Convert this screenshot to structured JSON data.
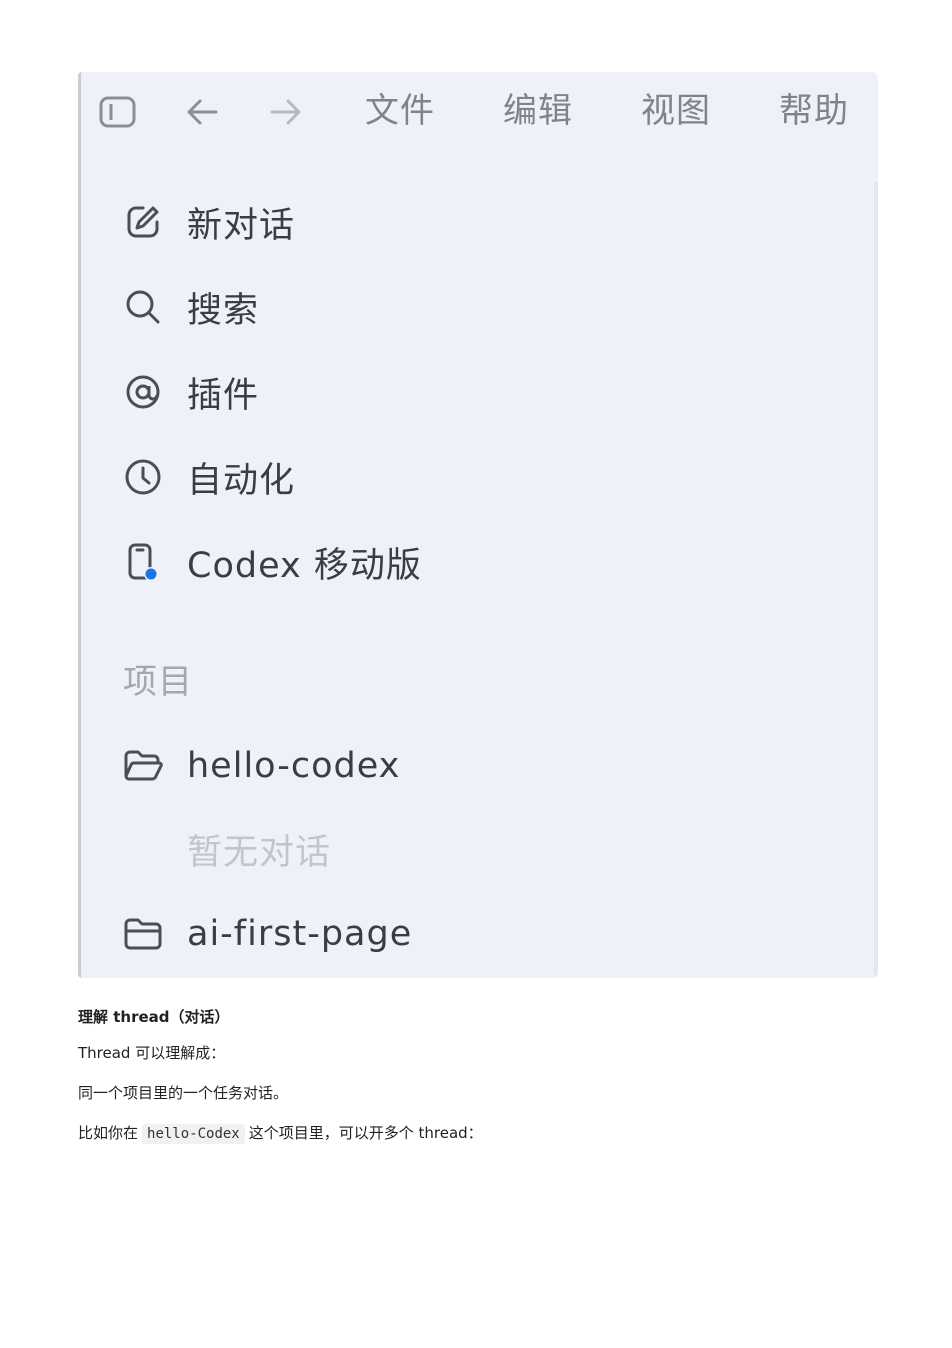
{
  "toolbar": {
    "menus": [
      "文件",
      "编辑",
      "视图",
      "帮助"
    ]
  },
  "nav": [
    {
      "label": "新对话",
      "icon": "edit-icon"
    },
    {
      "label": "搜索",
      "icon": "search-icon"
    },
    {
      "label": "插件",
      "icon": "at-icon"
    },
    {
      "label": "自动化",
      "icon": "clock-icon"
    },
    {
      "label": "Codex 移动版",
      "icon": "mobile-icon"
    }
  ],
  "projects": {
    "title": "项目",
    "items": [
      {
        "name": "hello-codex",
        "icon": "folder-open-icon"
      },
      {
        "name": "ai-first-page",
        "icon": "folder-icon"
      }
    ],
    "empty_note": "暂无对话"
  },
  "doc": {
    "heading": "理解 thread（对话）",
    "line1": "Thread 可以理解成：",
    "line2": "同一个项目里的一个任务对话。",
    "line3_before": "比如你在",
    "line3_code": "hello-Codex",
    "line3_after": "这个项目里，可以开多个 thread："
  },
  "colors": {
    "panel_bg": "#eef2f8",
    "mobile_dot": "#1a73e8"
  }
}
